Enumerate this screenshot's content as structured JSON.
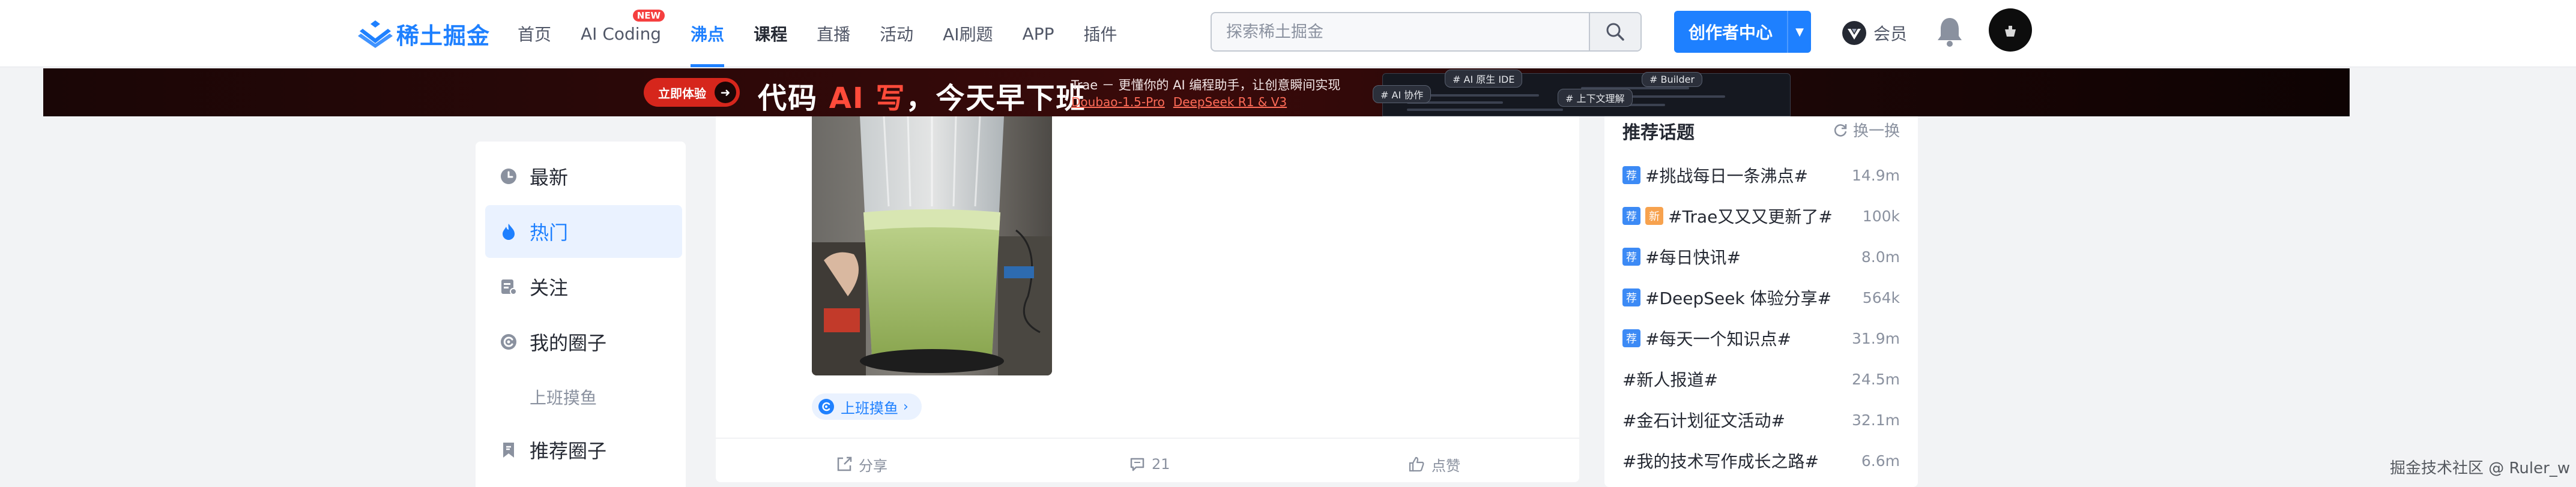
{
  "brand": {
    "name": "稀土掘金",
    "primary_color": "#1e80ff"
  },
  "nav": {
    "items": [
      {
        "label": "首页",
        "state": "normal"
      },
      {
        "label": "AI Coding",
        "state": "normal",
        "badge": "NEW"
      },
      {
        "label": "沸点",
        "state": "active"
      },
      {
        "label": "课程",
        "state": "current"
      },
      {
        "label": "直播",
        "state": "normal"
      },
      {
        "label": "活动",
        "state": "normal"
      },
      {
        "label": "AI刷题",
        "state": "normal"
      },
      {
        "label": "APP",
        "state": "normal"
      },
      {
        "label": "插件",
        "state": "normal"
      }
    ]
  },
  "search": {
    "placeholder": "探索稀土掘金",
    "value": ""
  },
  "header_actions": {
    "creator_label": "创作者中心",
    "vip_label": "会员",
    "icons": [
      "search-icon",
      "chevron-down-icon",
      "vip-icon",
      "bell-icon",
      "avatar"
    ]
  },
  "banner": {
    "cta_label": "立即体验",
    "headline_prefix": "代码 ",
    "headline_highlight": "AI 写",
    "headline_suffix": "，今天早下班",
    "subtitle": "Trae － 更懂你的 AI 编程助手，让创意瞬间实现",
    "links": [
      "Doubao-1.5-Pro",
      "DeepSeek R1 & V3"
    ],
    "chips": [
      "# AI 原生 IDE",
      "# Builder",
      "# AI 协作",
      "# 上下文理解"
    ],
    "accent_color": "#d6261c"
  },
  "sidebar": {
    "items": [
      {
        "label": "最新",
        "icon": "clock-icon",
        "active": false
      },
      {
        "label": "热门",
        "icon": "flame-icon",
        "active": true
      },
      {
        "label": "关注",
        "icon": "follow-icon",
        "active": false
      },
      {
        "label": "我的圈子",
        "icon": "circle-icon",
        "active": false
      },
      {
        "label": "上班摸鱼",
        "icon": "",
        "active": false,
        "sub": true
      },
      {
        "label": "推荐圈子",
        "icon": "bookmark-icon",
        "active": false
      }
    ]
  },
  "pin": {
    "circle_tag": "上班摸鱼",
    "actions": {
      "share_label": "分享",
      "comment_count": "21",
      "like_label": "点赞"
    }
  },
  "topics": {
    "title": "推荐话题",
    "refresh_label": "换一换",
    "items": [
      {
        "name": "#挑战每日一条沸点#",
        "count": "14.9m",
        "badges": [
          "荐"
        ]
      },
      {
        "name": "#Trae又又又更新了#",
        "count": "100k",
        "badges": [
          "荐",
          "新"
        ]
      },
      {
        "name": "#每日快讯#",
        "count": "8.0m",
        "badges": [
          "荐"
        ]
      },
      {
        "name": "#DeepSeek 体验分享#",
        "count": "564k",
        "badges": [
          "荐"
        ]
      },
      {
        "name": "#每天一个知识点#",
        "count": "31.9m",
        "badges": [
          "荐"
        ]
      },
      {
        "name": "#新人报道#",
        "count": "24.5m",
        "badges": []
      },
      {
        "name": "#金石计划征文活动#",
        "count": "32.1m",
        "badges": []
      },
      {
        "name": "#我的技术写作成长之路#",
        "count": "6.6m",
        "badges": []
      }
    ]
  },
  "watermark": "掘金技术社区 @ Ruler_w"
}
